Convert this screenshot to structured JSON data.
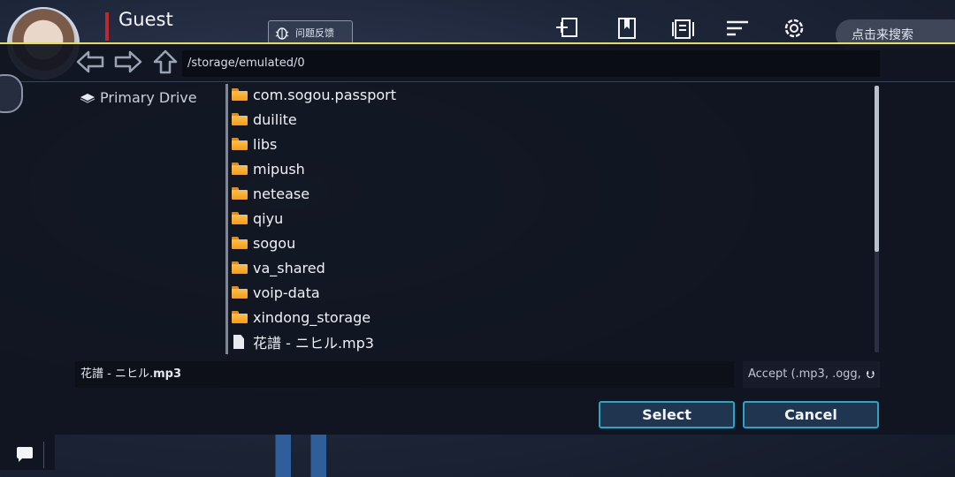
{
  "header": {
    "username": "Guest",
    "feedback_label": "问题反馈",
    "search_placeholder": "点击来搜索"
  },
  "navigation": {
    "path": "/storage/emulated/0"
  },
  "sidebar": {
    "drive_label": "Primary Drive"
  },
  "files": [
    {
      "name": "com.sogou.passport",
      "type": "folder"
    },
    {
      "name": "duilite",
      "type": "folder"
    },
    {
      "name": "libs",
      "type": "folder"
    },
    {
      "name": "mipush",
      "type": "folder"
    },
    {
      "name": "netease",
      "type": "folder"
    },
    {
      "name": "qiyu",
      "type": "folder"
    },
    {
      "name": "sogou",
      "type": "folder"
    },
    {
      "name": "va_shared",
      "type": "folder"
    },
    {
      "name": "voip-data",
      "type": "folder"
    },
    {
      "name": "xindong_storage",
      "type": "folder"
    },
    {
      "name": "花譜 - ニヒル.mp3",
      "type": "file"
    }
  ],
  "footer": {
    "filename_prefix": "花譜 - ニヒル.",
    "filename_ext": "mp3",
    "accept_label": "Accept (.mp3, .ogg,",
    "select_label": "Select",
    "cancel_label": "Cancel"
  },
  "colors": {
    "accent_border": "#29a6c4",
    "header_line": "#e8e04a",
    "name_marker": "#c0282f"
  }
}
